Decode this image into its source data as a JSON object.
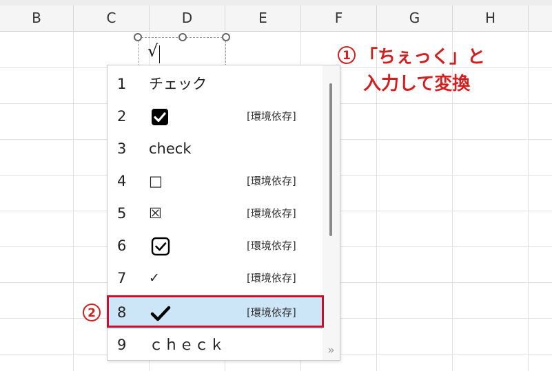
{
  "columns": [
    "B",
    "C",
    "D",
    "E",
    "F",
    "G",
    "H"
  ],
  "cell": {
    "value": "√"
  },
  "candidates": [
    {
      "number": "1",
      "text": "チェック",
      "tag": ""
    },
    {
      "number": "2",
      "icon": "checkbox-checked-filled-icon",
      "tag": "[環境依存]"
    },
    {
      "number": "3",
      "text": "check",
      "tag": ""
    },
    {
      "number": "4",
      "text": "□",
      "tag": "[環境依存]"
    },
    {
      "number": "5",
      "text": "☒",
      "tag": "[環境依存]"
    },
    {
      "number": "6",
      "icon": "checkbox-checked-outline-icon",
      "tag": "[環境依存]"
    },
    {
      "number": "7",
      "text": "✓",
      "tag": "[環境依存]"
    },
    {
      "number": "8",
      "icon": "heavy-check-mark-icon",
      "tag": "[環境依存]",
      "selected": true
    },
    {
      "number": "9",
      "text": "ｃｈｅｃｋ",
      "tag": ""
    }
  ],
  "expand_label": "»",
  "annotations": {
    "step1_badge": "1",
    "step1_line1": "「ちぇっく」と",
    "step1_line2": "入力して変換",
    "step2_badge": "2"
  },
  "colors": {
    "selected_row": "#cde6f7",
    "highlight_border": "#c8102e",
    "annotation": "#d21f1f"
  }
}
